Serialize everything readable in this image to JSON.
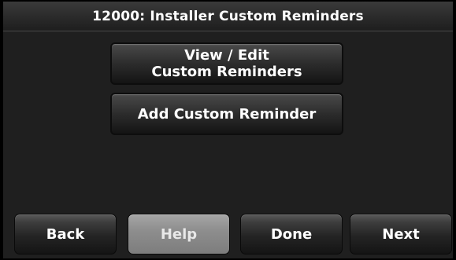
{
  "title": "12000: Installer Custom Reminders",
  "menu": {
    "view_edit_line1": "View / Edit",
    "view_edit_line2": "Custom Reminders",
    "add_label": "Add Custom Reminder"
  },
  "nav": {
    "back_label": "Back",
    "help_label": "Help",
    "done_label": "Done",
    "next_label": "Next"
  },
  "colors": {
    "background": "#000000",
    "panel": "#1f1f1f",
    "button_dark": "#2c2c2c",
    "button_help": "#8e8e8e",
    "text": "#ffffff"
  }
}
